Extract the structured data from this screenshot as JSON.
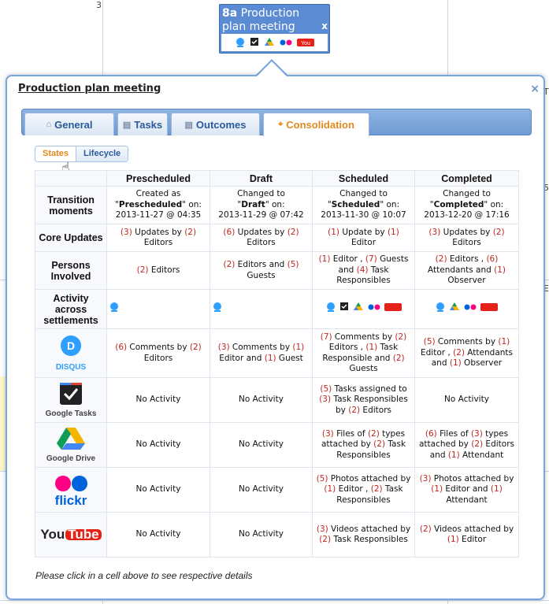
{
  "event": {
    "id": "8a",
    "title": "Production plan meeting",
    "close": "x"
  },
  "popup": {
    "title": "Production plan meeting",
    "close": "×",
    "footer": "Please click in a cell above to see respective details"
  },
  "tabs": [
    {
      "label": "General",
      "icon": "home-icon"
    },
    {
      "label": "Tasks",
      "icon": "comment-icon"
    },
    {
      "label": "Outcomes",
      "icon": "folder-icon"
    },
    {
      "label": "Consolidation",
      "icon": "consolidation-icon",
      "active": true
    }
  ],
  "subtabs": [
    {
      "label": "States",
      "active": true
    },
    {
      "label": "Lifecycle"
    }
  ],
  "columns": [
    "Prescheduled",
    "Draft",
    "Scheduled",
    "Completed"
  ],
  "row_labels": {
    "transition": "Transition moments",
    "core": "Core Updates",
    "persons": "Persons Involved",
    "activity": "Activity across settlements",
    "google_tasks": "Google Tasks",
    "google_drive": "Google Drive",
    "flickr": "flickr",
    "youtube_you": "You",
    "youtube_tube": "Tube",
    "disqus": "DISQUS"
  },
  "transition": [
    {
      "prefix": "Created as",
      "state": "Prescheduled",
      "on": "on:",
      "date": "2013-11-27 @ 04:35"
    },
    {
      "prefix": "Changed to",
      "state": "Draft",
      "on": "on:",
      "date": "2013-11-29 @ 07:42"
    },
    {
      "prefix": "Changed to",
      "state": "Scheduled",
      "on": "on:",
      "date": "2013-11-30 @ 10:07"
    },
    {
      "prefix": "Changed to",
      "state": "Completed",
      "on": "on:",
      "date": "2013-12-20 @ 17:16"
    }
  ],
  "no_activity": "No Activity",
  "icon_labels": {
    "disqus": "DISQUS",
    "gtasks": "Google Tasks",
    "gdrive": "Google Drive",
    "flickr": "flickr",
    "youtube": "YouTube"
  },
  "colors": {
    "accent": "#e08a1e",
    "number": "#c0261f",
    "tab_blue": "#6f9ad3",
    "chip_blue": "#5b8bd3",
    "disqus": "#2e9fff",
    "flickr_pink": "#ff0084",
    "flickr_blue": "#0063dc",
    "youtube_red": "#e62117"
  },
  "background": {
    "fragments": [
      "3",
      "5",
      "E",
      "T"
    ]
  }
}
